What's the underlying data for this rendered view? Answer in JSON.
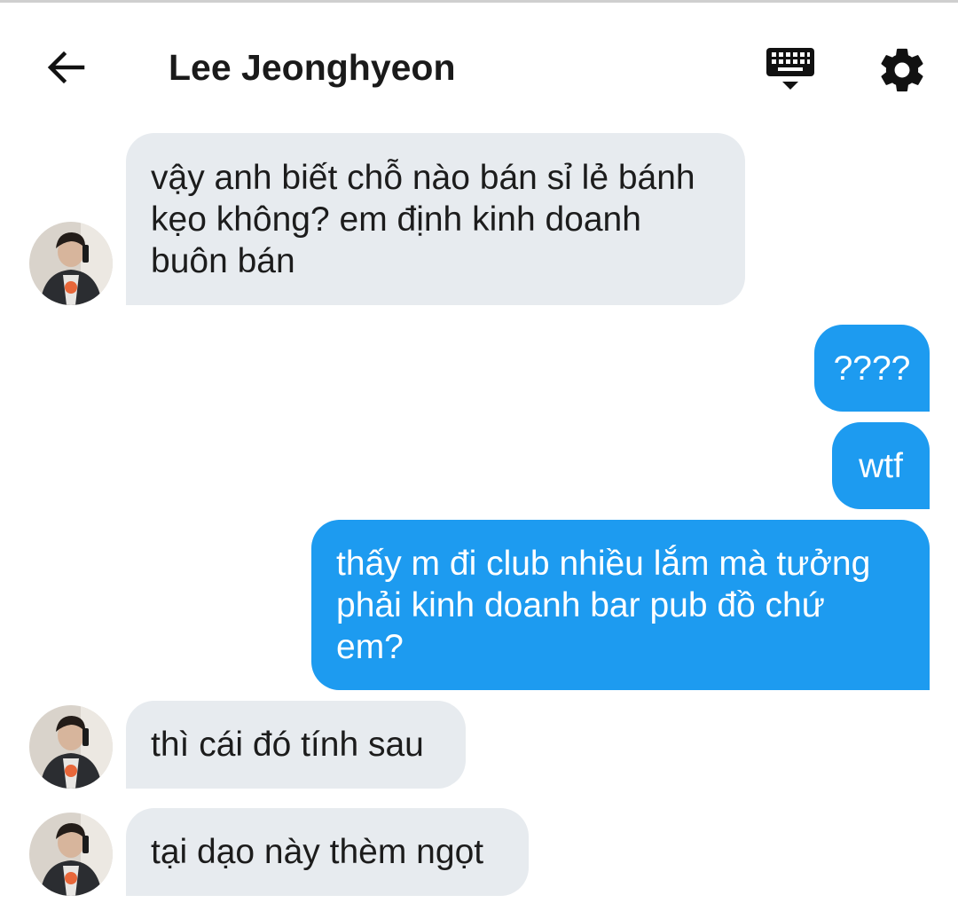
{
  "header": {
    "title": "Lee Jeonghyeon",
    "back_icon": "arrow-left-icon",
    "keyboard_icon": "keyboard-icon",
    "settings_icon": "gear-icon"
  },
  "colors": {
    "incoming_bubble": "#e7ebef",
    "outgoing_bubble": "#1d9bf0",
    "outgoing_text": "#ffffff",
    "incoming_text": "#1c1c1c"
  },
  "messages": [
    {
      "direction": "incoming",
      "text": "vậy anh biết chỗ nào bán sỉ lẻ bánh\nkẹo không? em định kinh doanh\nbuôn bán"
    },
    {
      "direction": "outgoing",
      "text": "????"
    },
    {
      "direction": "outgoing",
      "text": "wtf"
    },
    {
      "direction": "outgoing",
      "text": "thấy m đi club nhiều lắm mà tưởng\nphải kinh doanh bar pub đồ chứ\nem?"
    },
    {
      "direction": "incoming",
      "text": "thì cái đó tính sau"
    },
    {
      "direction": "incoming",
      "text": "tại dạo này thèm ngọt"
    }
  ]
}
